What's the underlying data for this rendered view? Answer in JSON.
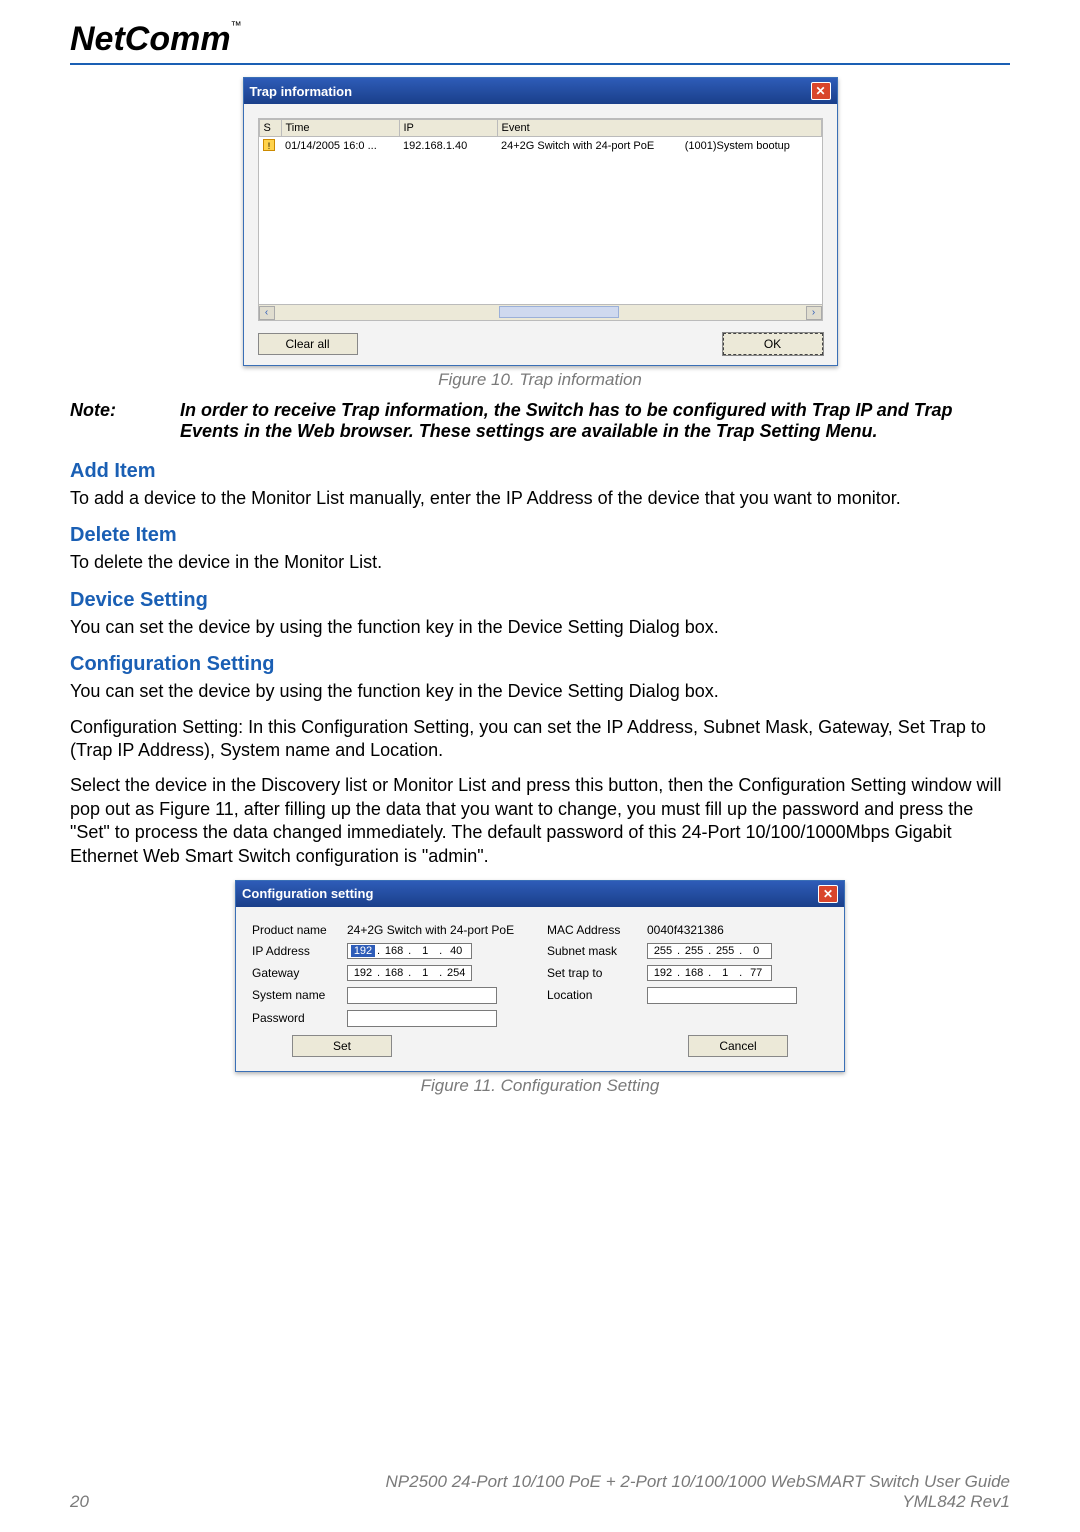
{
  "logo": {
    "text": "NetComm",
    "tm": "™"
  },
  "trap_dialog": {
    "title": "Trap information",
    "headers": {
      "s": "S",
      "time": "Time",
      "ip": "IP",
      "event": "Event"
    },
    "row": {
      "time": "01/14/2005 16:0 ...",
      "ip": "192.168.1.40",
      "event_a": "24+2G Switch with 24-port PoE",
      "event_b": "(1001)System bootup"
    },
    "clear": "Clear all",
    "ok": "OK"
  },
  "fig10": "Figure 10. Trap information",
  "note": {
    "label": "Note:",
    "text": "In order to receive Trap information, the Switch has to be configured with Trap IP and Trap Events in the Web browser. These settings are available in the Trap Setting Menu."
  },
  "sec_add": {
    "h": "Add Item",
    "p": "To add a device to the Monitor List manually, enter the IP Address of the device that you want to monitor."
  },
  "sec_del": {
    "h": "Delete Item",
    "p": "To delete the device in the Monitor List."
  },
  "sec_dev": {
    "h": "Device Setting",
    "p": "You can set the device by using the function key in the Device Setting Dialog box."
  },
  "sec_cfg": {
    "h": "Configuration Setting",
    "p1": "You can set the device by using the function key in the Device Setting Dialog box.",
    "p2": "Configuration Setting: In this Configuration Setting, you can set the IP Address, Subnet Mask, Gateway, Set Trap to (Trap IP Address), System name and Location.",
    "p3": "Select the device in the Discovery list or Monitor List and press this button, then the Configuration Setting window will pop out as Figure 11, after filling up the data that you want to change, you must fill up the password and press the \"Set\" to process the data changed immediately. The default password of this 24-Port 10/100/1000Mbps Gigabit Ethernet Web Smart Switch configuration is \"admin\"."
  },
  "cfg_dialog": {
    "title": "Configuration setting",
    "labels": {
      "product": "Product name",
      "ip": "IP Address",
      "gateway": "Gateway",
      "system": "System name",
      "password": "Password",
      "mac": "MAC Address",
      "subnet": "Subnet mask",
      "trap": "Set trap to",
      "location": "Location"
    },
    "values": {
      "product": "24+2G Switch with 24-port PoE",
      "mac": "0040f4321386",
      "ip": {
        "o1": "192",
        "o2": "168",
        "o3": "1",
        "o4": "40"
      },
      "subnet": {
        "o1": "255",
        "o2": "255",
        "o3": "255",
        "o4": "0"
      },
      "gateway": {
        "o1": "192",
        "o2": "168",
        "o3": "1",
        "o4": "254"
      },
      "trap": {
        "o1": "192",
        "o2": "168",
        "o3": "1",
        "o4": "77"
      }
    },
    "set": "Set",
    "cancel": "Cancel"
  },
  "fig11": "Figure 11. Configuration Setting",
  "footer": {
    "page": "20",
    "line1": "NP2500 24-Port 10/100 PoE + 2-Port 10/100/1000 WebSMART Switch User Guide",
    "line2": "YML842 Rev1"
  }
}
